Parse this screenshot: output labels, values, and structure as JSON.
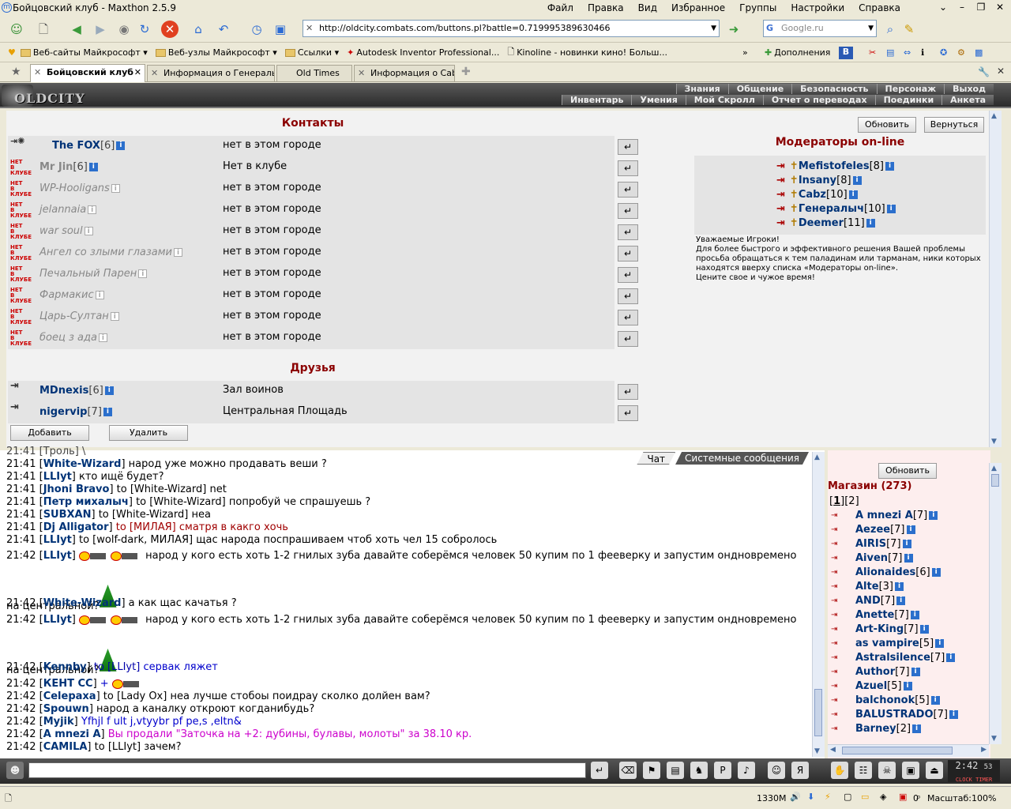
{
  "window": {
    "title": "Бойцовский клуб - Maxthon 2.5.9",
    "menu": [
      "Файл",
      "Правка",
      "Вид",
      "Избранное",
      "Группы",
      "Настройки",
      "Справка"
    ]
  },
  "address": {
    "url": "http://oldcity.combats.com/buttons.pl?battle=0.719995389630466"
  },
  "search": {
    "placeholder": "Google.ru"
  },
  "favorites": [
    "Веб-сайты Майкрософт",
    "Веб-узлы Майкрософт",
    "Ссылки",
    "Autodesk Inventor Professional...",
    "Kinoline - новинки кино! Больш..."
  ],
  "favorites_right": "Дополнения",
  "tabs": [
    {
      "label": "Бойцовский клуб",
      "active": true
    },
    {
      "label": "Информация о Генералыч",
      "active": false
    },
    {
      "label": "Old Times",
      "active": false
    },
    {
      "label": "Информация о Cabz",
      "active": false
    }
  ],
  "game": {
    "logo": "OLDCITY",
    "nav_top": [
      "Знания",
      "Общение",
      "Безопасность",
      "Персонаж",
      "Выход"
    ],
    "nav_bottom": [
      "Инвентарь",
      "Умения",
      "Мой Скролл",
      "Отчет о переводах",
      "Поединки",
      "Анкета"
    ]
  },
  "contacts": {
    "title": "Контакты",
    "refresh": "Обновить",
    "back": "Вернуться",
    "rows": [
      {
        "name": "The FOX",
        "level": "[6]",
        "location": "нет в этом городе",
        "status": "online"
      },
      {
        "name": "Mr Jin",
        "level": "[6]",
        "location": "Нет в клубе",
        "status": "off-bold"
      },
      {
        "name": "WP-Hooligans",
        "level": "",
        "location": "нет в этом городе",
        "status": "off"
      },
      {
        "name": "jelannaia",
        "level": "",
        "location": "нет в этом городе",
        "status": "off"
      },
      {
        "name": "war soul",
        "level": "",
        "location": "нет в этом городе",
        "status": "off"
      },
      {
        "name": "Ангел со злыми глазами",
        "level": "",
        "location": "нет в этом городе",
        "status": "off"
      },
      {
        "name": "Печальный Парен",
        "level": "",
        "location": "нет в этом городе",
        "status": "off"
      },
      {
        "name": "Фармакис",
        "level": "",
        "location": "нет в этом городе",
        "status": "off"
      },
      {
        "name": "Царь-Султан",
        "level": "",
        "location": "нет в этом городе",
        "status": "off"
      },
      {
        "name": "боец з ада",
        "level": "",
        "location": "нет в этом городе",
        "status": "off"
      }
    ],
    "offline_badge": "НЕТ В КЛУБЕ"
  },
  "friends": {
    "title": "Друзья",
    "rows": [
      {
        "name": "MDnexis",
        "level": "[6]",
        "location": "Зал воинов"
      },
      {
        "name": "nigervip",
        "level": "[7]",
        "location": "Центральная Площадь"
      }
    ],
    "add": "Добавить",
    "remove": "Удалить"
  },
  "moderators": {
    "title": "Модераторы on-line",
    "list": [
      {
        "name": "Mefistofeles",
        "level": "[8]"
      },
      {
        "name": "Insany",
        "level": "[8]"
      },
      {
        "name": "Cabz",
        "level": "[10]"
      },
      {
        "name": "Генералыч",
        "level": "[10]"
      },
      {
        "name": "Deemer",
        "level": "[11]"
      }
    ],
    "notice": [
      "Уважаемые Игроки!",
      "Для более быстрого и эффективного решения Вашей проблемы просьба обращаться к тем паладинам или тарманам, ники которых находятся вверху списка «Модераторы on-line».",
      "Цените свое и чужое время!"
    ]
  },
  "chat": {
    "tabs": [
      "Чат",
      "Системные сообщения"
    ],
    "top_cut": "21:41 [Троль] \\",
    "lines": [
      {
        "t": "21:41",
        "n": "White-Wizard",
        "to": "",
        "msg": "народ уже можно продавать веши ?"
      },
      {
        "t": "21:41",
        "n": "LLIyt",
        "to": "",
        "msg": "кто ищё будет?"
      },
      {
        "t": "21:41",
        "n": "Jhoni Bravo",
        "to": "to [White-Wizard]",
        "msg": "net"
      },
      {
        "t": "21:41",
        "n": "Петр михалыч",
        "to": "to [White-Wizard]",
        "msg": "попробуй че спрашуешь ?"
      },
      {
        "t": "21:41",
        "n": "SUBXAN",
        "to": "to [White-Wizard]",
        "msg": "неа"
      },
      {
        "t": "21:41",
        "n": "Dj Alligator",
        "to": "to [МИЛАЯ]",
        "msg": "сматря в какго хочь"
      },
      {
        "t": "21:41",
        "n": "LLIyt",
        "to": "to [wolf-dark, МИЛАЯ]",
        "msg": "щас народа поспрашиваем чтоб хоть чел 15 собролось"
      }
    ],
    "long_msg": "народ у кого есть хоть 1-2 гнилых зуба давайте соберёмся человек 50 купим по 1 фееверку и запустим ондновремено",
    "long_msg2": "на центральной?",
    "l42a": {
      "t": "21:42",
      "n": "LLIyt"
    },
    "l42b": {
      "t": "21:42",
      "n": "White-Wizard",
      "msg": "а как щас качатья ?"
    },
    "l42c": {
      "t": "21:42",
      "n": "LLIyt"
    },
    "l42d": {
      "t": "21:42",
      "n": "Kennby",
      "to": "to [LLIyt]",
      "msg": "сервак ляжет"
    },
    "l42e": {
      "t": "21:42",
      "n": "КЕНТ СС",
      "msg": "+"
    },
    "l42f": {
      "t": "21:42",
      "n": "Celepaxa",
      "to": "to [Lady Ox]",
      "msg": "неа лучше стобоы поидрау сколко долйен вам?"
    },
    "l42g": {
      "t": "21:42",
      "n": "Spouwn",
      "msg": "народ а каналку откроют когданибудь?"
    },
    "l42h": {
      "t": "21:42",
      "n": "Myjik",
      "msg": "Yfhjl f ult j,vtyybr pf pe,s ,eltn&"
    },
    "l42i": {
      "t": "21:42",
      "n": "A mnezi A",
      "msg": "Вы продали \"Заточка на +2: дубины, булавы, молоты\" за 38.10 кр."
    },
    "l42j": {
      "t": "21:42",
      "n": "CAMILA",
      "to": "to [LLIyt]",
      "msg": "зачем?"
    }
  },
  "room": {
    "refresh": "Обновить",
    "title": "Магазин (273)",
    "pages": [
      "1",
      "2"
    ],
    "users": [
      {
        "name": "A mnezi A",
        "level": "[7]"
      },
      {
        "name": "Aezee",
        "level": "[7]"
      },
      {
        "name": "AIRIS",
        "level": "[7]"
      },
      {
        "name": "Aiven",
        "level": "[7]"
      },
      {
        "name": "Alionaides",
        "level": "[6]"
      },
      {
        "name": "Alte",
        "level": "[3]"
      },
      {
        "name": "AND",
        "level": "[7]"
      },
      {
        "name": "Anette",
        "level": "[7]"
      },
      {
        "name": "Art-King",
        "level": "[7]"
      },
      {
        "name": "as vampire",
        "level": "[5]"
      },
      {
        "name": "Astralsilence",
        "level": "[7]"
      },
      {
        "name": "Author",
        "level": "[7]"
      },
      {
        "name": "Azuel",
        "level": "[5]"
      },
      {
        "name": "balchonok",
        "level": "[5]"
      },
      {
        "name": "BALUSTRADO",
        "level": "[7]"
      },
      {
        "name": "Barney",
        "level": "[2]"
      }
    ]
  },
  "clock": {
    "time": "2:42",
    "sec": "53",
    "label": "CLOCK TIMER"
  },
  "statusbar": {
    "mem": "1330M",
    "count": "0",
    "zoom": "Масштаб:100%"
  }
}
